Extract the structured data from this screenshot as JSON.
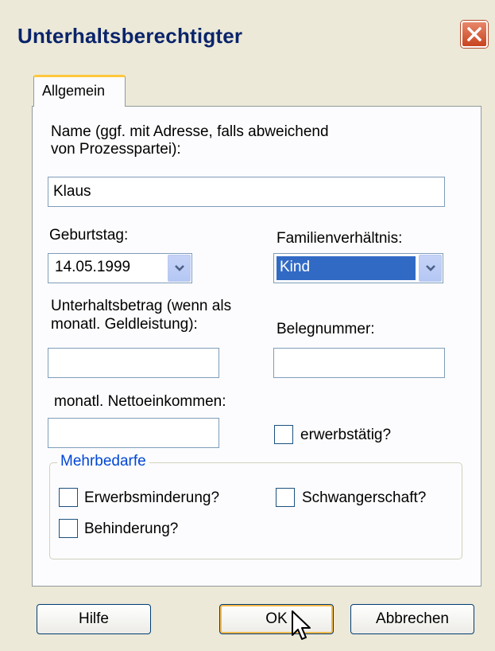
{
  "window": {
    "title": "Unterhaltsberechtigter",
    "close_icon": "close-icon"
  },
  "tabs": [
    {
      "label": "Allgemein",
      "active": true
    }
  ],
  "form": {
    "name_label_line1": "Name (ggf. mit Adresse, falls abweichend",
    "name_label_line2": "von Prozesspartei):",
    "name_value": "Klaus",
    "birthday_label": "Geburtstag:",
    "birthday_value": "14.05.1999",
    "family_label": "Familienverhältnis:",
    "family_value": "Kind",
    "support_label_line1": "Unterhaltsbetrag (wenn als",
    "support_label_line2": "monatl. Geldleistung):",
    "support_value": "",
    "receipt_label": "Belegnummer:",
    "receipt_value": "",
    "income_label": "monatl. Nettoeinkommen:",
    "income_value": "",
    "employed_label": "erwerbstätig?",
    "employed_checked": false
  },
  "mehrbedarfe": {
    "legend": "Mehrbedarfe",
    "reduced_earning_label": "Erwerbsminderung?",
    "reduced_earning_checked": false,
    "pregnancy_label": "Schwangerschaft?",
    "pregnancy_checked": false,
    "disability_label": "Behinderung?",
    "disability_checked": false
  },
  "buttons": {
    "help": "Hilfe",
    "ok": "OK",
    "cancel": "Abbrechen"
  },
  "colors": {
    "title_text": "#0a246a",
    "selection": "#316ac5",
    "group_legend": "#0046d5",
    "close_button": "#c8431f"
  }
}
